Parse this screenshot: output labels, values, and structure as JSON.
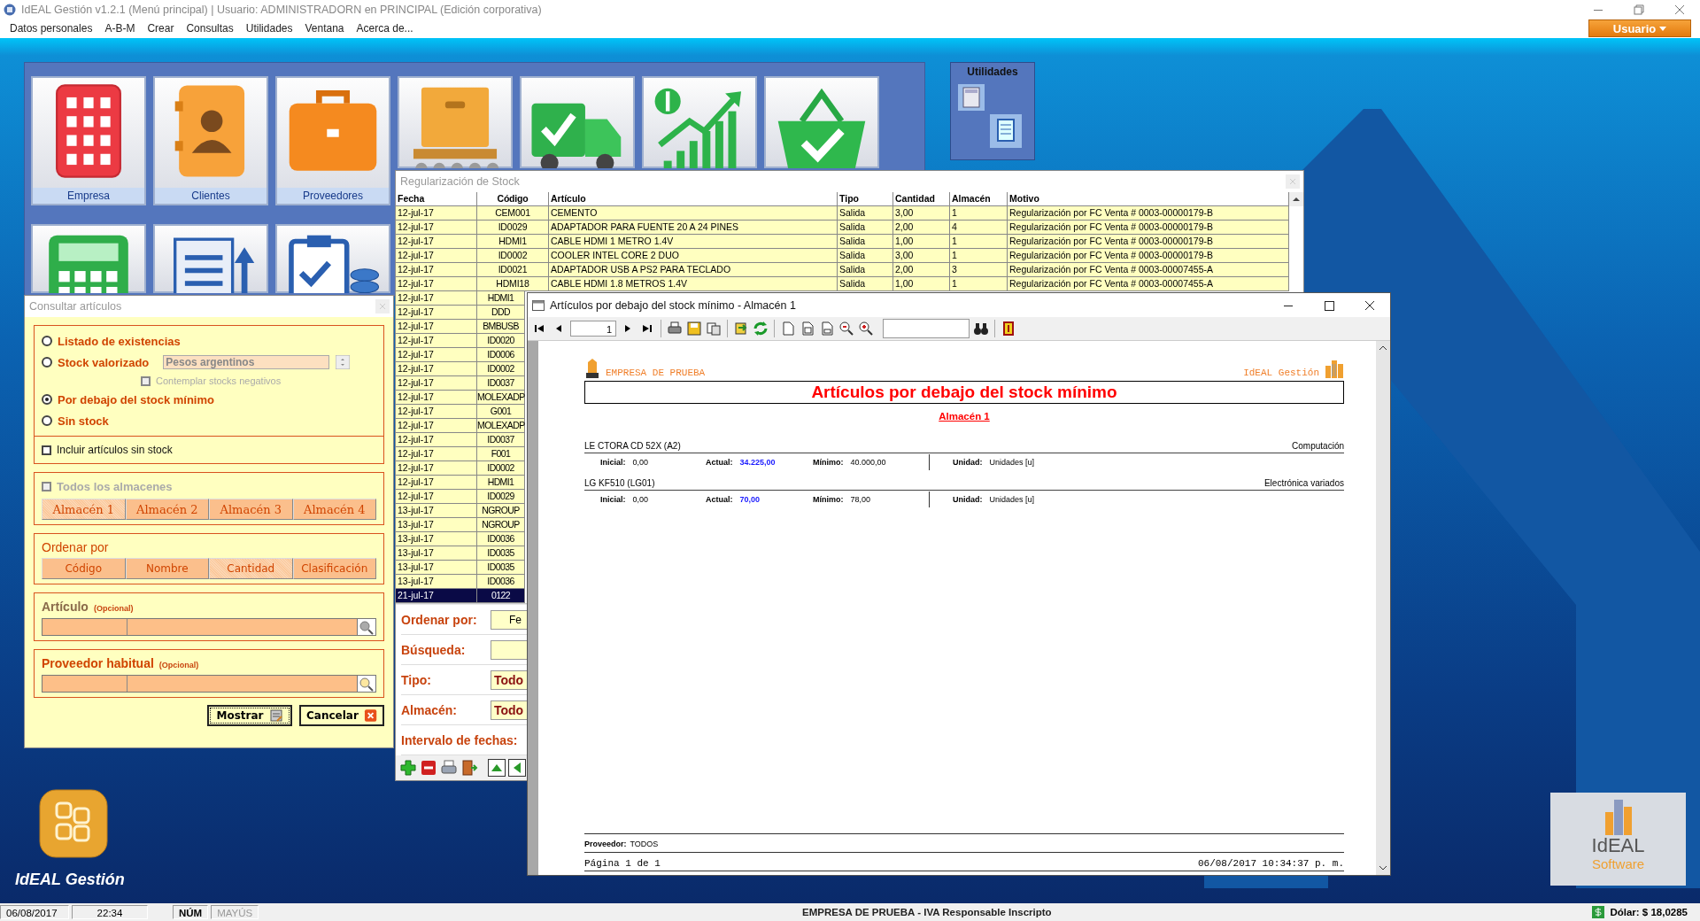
{
  "app_window": {
    "title": "IdEAL Gestión v1.2.1 (Menú principal) | Usuario: ADMINISTRADORN en PRINCIPAL (Edición corporativa)"
  },
  "menu": [
    "Datos personales",
    "A-B-M",
    "Crear",
    "Consultas",
    "Utilidades",
    "Ventana",
    "Acerca de..."
  ],
  "user_button": {
    "label": "Usuario"
  },
  "tile_labels": [
    "Empresa",
    "Clientes",
    "Proveedores"
  ],
  "utilities_panel": {
    "title": "Utilidades"
  },
  "stock_window": {
    "title": "Regularización de Stock",
    "columns": [
      "Fecha",
      "Código",
      "Artículo",
      "Tipo",
      "Cantidad",
      "Almacén",
      "Motivo"
    ],
    "rows": [
      {
        "cells": [
          "12-jul-17",
          "CEM001",
          "CEMENTO",
          "Salida",
          "3,00",
          "1",
          "Regularización por FC Venta # 0003-00000179-B"
        ],
        "selected": false
      },
      {
        "cells": [
          "12-jul-17",
          "ID0029",
          "ADAPTADOR PARA FUENTE 20 A 24 PINES",
          "Salida",
          "2,00",
          "4",
          "Regularización por FC Venta # 0003-00000179-B"
        ],
        "selected": false
      },
      {
        "cells": [
          "12-jul-17",
          "HDMI1",
          "CABLE HDMI 1 METRO 1.4V",
          "Salida",
          "1,00",
          "1",
          "Regularización por FC Venta # 0003-00000179-B"
        ],
        "selected": false
      },
      {
        "cells": [
          "12-jul-17",
          "ID0002",
          "COOLER INTEL CORE 2 DUO",
          "Salida",
          "3,00",
          "1",
          "Regularización por FC Venta # 0003-00000179-B"
        ],
        "selected": false
      },
      {
        "cells": [
          "12-jul-17",
          "ID0021",
          "ADAPTADOR USB A PS2 PARA TECLADO",
          "Salida",
          "2,00",
          "3",
          "Regularización por FC Venta # 0003-00007455-A"
        ],
        "selected": false
      },
      {
        "cells": [
          "12-jul-17",
          "HDMI18",
          "CABLE HDMI 1.8 METROS 1.4V",
          "Salida",
          "1,00",
          "1",
          "Regularización por FC Venta # 0003-00007455-A"
        ],
        "selected": false
      },
      {
        "cells": [
          "12-jul-17",
          "HDMI1"
        ],
        "selected": false
      },
      {
        "cells": [
          "12-jul-17",
          "DDD"
        ],
        "selected": false
      },
      {
        "cells": [
          "12-jul-17",
          "BMBUSB"
        ],
        "selected": false
      },
      {
        "cells": [
          "12-jul-17",
          "ID0020"
        ],
        "selected": false
      },
      {
        "cells": [
          "12-jul-17",
          "ID0006"
        ],
        "selected": false
      },
      {
        "cells": [
          "12-jul-17",
          "ID0002"
        ],
        "selected": false
      },
      {
        "cells": [
          "12-jul-17",
          "ID0037"
        ],
        "selected": false
      },
      {
        "cells": [
          "12-jul-17",
          "MOLEXADP"
        ],
        "selected": false
      },
      {
        "cells": [
          "12-jul-17",
          "G001"
        ],
        "selected": false
      },
      {
        "cells": [
          "12-jul-17",
          "MOLEXADP"
        ],
        "selected": false
      },
      {
        "cells": [
          "12-jul-17",
          "ID0037"
        ],
        "selected": false
      },
      {
        "cells": [
          "12-jul-17",
          "F001"
        ],
        "selected": false
      },
      {
        "cells": [
          "12-jul-17",
          "ID0002"
        ],
        "selected": false
      },
      {
        "cells": [
          "12-jul-17",
          "HDMI1"
        ],
        "selected": false
      },
      {
        "cells": [
          "12-jul-17",
          "ID0029"
        ],
        "selected": false
      },
      {
        "cells": [
          "13-jul-17",
          "NGROUP"
        ],
        "selected": false
      },
      {
        "cells": [
          "13-jul-17",
          "NGROUP"
        ],
        "selected": false
      },
      {
        "cells": [
          "13-jul-17",
          "ID0036"
        ],
        "selected": false
      },
      {
        "cells": [
          "13-jul-17",
          "ID0035"
        ],
        "selected": false
      },
      {
        "cells": [
          "13-jul-17",
          "ID0035"
        ],
        "selected": false
      },
      {
        "cells": [
          "13-jul-17",
          "ID0036"
        ],
        "selected": false
      },
      {
        "cells": [
          "21-jul-17",
          "0122"
        ],
        "selected": true
      }
    ],
    "filters": [
      {
        "label": "Ordenar por:",
        "kind": "text-field",
        "value": "Fe"
      },
      {
        "label": "Búsqueda:",
        "kind": "text-field"
      },
      {
        "label": "Tipo:",
        "kind": "select-field",
        "value": "Todo"
      },
      {
        "label": "Almacén:",
        "kind": "select-field",
        "value": "Todo"
      },
      {
        "label": "Intervalo de fechas:",
        "kind": "date-range"
      }
    ]
  },
  "consult_dialog": {
    "title": "Consultar artículos",
    "report_types": [
      {
        "label": "Listado de existencias",
        "selected": false
      },
      {
        "label": "Stock valorizado",
        "selected": false
      },
      {
        "label": "Por debajo del stock mínimo",
        "selected": true
      },
      {
        "label": "Sin stock",
        "selected": false
      }
    ],
    "currency": {
      "value": "Pesos argentinos"
    },
    "negative_stocks": {
      "label": "Contemplar stocks negativos",
      "checked": false,
      "disabled": true
    },
    "include_no_stock": {
      "label": "Incluir artículos sin stock",
      "checked": false,
      "disabled": false
    },
    "all_warehouses": {
      "label": "Todos los almacenes",
      "checked": false,
      "disabled": true
    },
    "warehouses": [
      {
        "label": "Almacén 1",
        "selected": true
      },
      {
        "label": "Almacén 2",
        "selected": false
      },
      {
        "label": "Almacén 3",
        "selected": false
      },
      {
        "label": "Almacén 4",
        "selected": false
      }
    ],
    "sort": {
      "title": "Ordenar por",
      "options": [
        {
          "label": "Código",
          "selected": false
        },
        {
          "label": "Nombre",
          "selected": false
        },
        {
          "label": "Cantidad",
          "selected": true
        },
        {
          "label": "Clasificación",
          "selected": false
        }
      ]
    },
    "article": {
      "label": "Artículo",
      "hint": "(Opcional)"
    },
    "supplier": {
      "label": "Proveedor habitual",
      "hint": "(Opcional)"
    },
    "buttons": [
      {
        "label": "Mostrar",
        "kind": "ok"
      },
      {
        "label": "Cancelar",
        "kind": "cancel"
      }
    ]
  },
  "report_window": {
    "title": "Artículos por debajo del stock mínimo - Almacén 1",
    "page": "1",
    "company": "EMPRESA DE PRUEBA",
    "brand": "IdEAL Gestión",
    "heading": "Artículos por debajo del stock mínimo",
    "subheading": "Almacén 1",
    "items": [
      {
        "name": "LE CTORA CD 52X (A2)",
        "category": "Computación",
        "fields": [
          {
            "label": "Inicial:",
            "value": "0,00",
            "kind": "plain"
          },
          {
            "label": "Actual:",
            "value": "34.225,00",
            "kind": "highlight"
          },
          {
            "label": "Mínimo:",
            "value": "40.000,00",
            "kind": "plain"
          },
          {
            "label": "Unidad:",
            "value": "Unidades [u]",
            "kind": "plain"
          }
        ]
      },
      {
        "name": "LG KF510 (LG01)",
        "category": "Electrónica variados",
        "fields": [
          {
            "label": "Inicial:",
            "value": "0,00",
            "kind": "plain"
          },
          {
            "label": "Actual:",
            "value": "70,00",
            "kind": "highlight"
          },
          {
            "label": "Mínimo:",
            "value": "78,00",
            "kind": "plain"
          },
          {
            "label": "Unidad:",
            "value": "Unidades [u]",
            "kind": "plain"
          }
        ]
      }
    ],
    "footer_supplier": {
      "label": "Proveedor:",
      "value": "TODOS"
    },
    "page_label": "Página 1 de 1",
    "timestamp": "06/08/2017 10:34:37 p. m."
  },
  "desktop_logo": {
    "label": "IdEAL Gestión"
  },
  "software_badge": {
    "line1": "IdEAL",
    "line2": "Software"
  },
  "status_bar": {
    "date": "06/08/2017",
    "time": "22:34",
    "indicators": [
      {
        "label": "NÚM",
        "on": true
      },
      {
        "label": "MAYÚS",
        "on": false
      }
    ],
    "company": "EMPRESA DE PRUEBA - IVA Responsable Inscripto",
    "dollar": "Dólar: $ 18,0285"
  }
}
